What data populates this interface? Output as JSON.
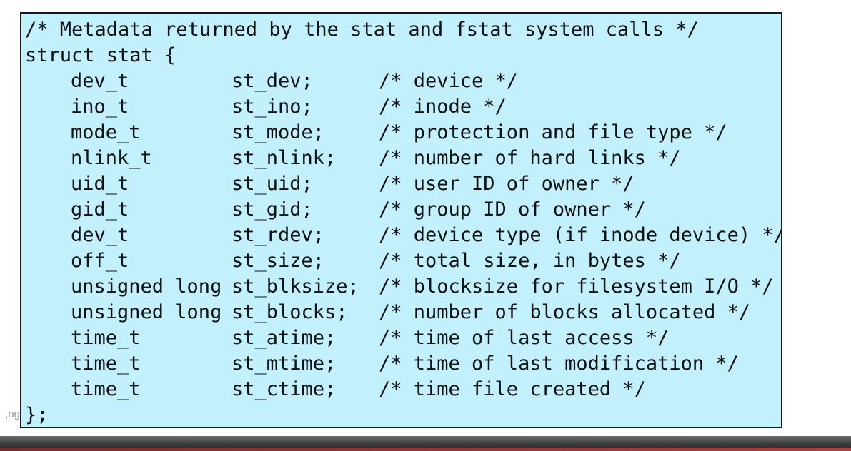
{
  "footer_fragment": "ng,",
  "code": {
    "header_comment": "/* Metadata returned by the stat and fstat system calls */",
    "struct_open": "struct stat {",
    "fields": [
      {
        "type": "dev_t",
        "name": "st_dev;",
        "comment": "/* device */"
      },
      {
        "type": "ino_t",
        "name": "st_ino;",
        "comment": "/* inode */"
      },
      {
        "type": "mode_t",
        "name": "st_mode;",
        "comment": "/* protection and file type */"
      },
      {
        "type": "nlink_t",
        "name": "st_nlink;",
        "comment": "/* number of hard links */"
      },
      {
        "type": "uid_t",
        "name": "st_uid;",
        "comment": "/* user ID of owner */"
      },
      {
        "type": "gid_t",
        "name": "st_gid;",
        "comment": "/* group ID of owner */"
      },
      {
        "type": "dev_t",
        "name": "st_rdev;",
        "comment": "/* device type (if inode device) */"
      },
      {
        "type": "off_t",
        "name": "st_size;",
        "comment": "/* total size, in bytes */"
      },
      {
        "type": "unsigned long",
        "name": "st_blksize;",
        "comment": "/* blocksize for filesystem I/O */"
      },
      {
        "type": "unsigned long",
        "name": "st_blocks;",
        "comment": "/* number of blocks allocated */"
      },
      {
        "type": "time_t",
        "name": "st_atime;",
        "comment": "/* time of last access */"
      },
      {
        "type": "time_t",
        "name": "st_mtime;",
        "comment": "/* time of last modification */"
      },
      {
        "type": "time_t",
        "name": "st_ctime;",
        "comment": "/* time file created */"
      }
    ],
    "struct_close": "};"
  },
  "colors": {
    "code_background": "#c2f0fd",
    "code_border": "#1a1a1a",
    "bottom_bar": "#3a3a3a",
    "bottom_accent": "#b33b3b"
  }
}
